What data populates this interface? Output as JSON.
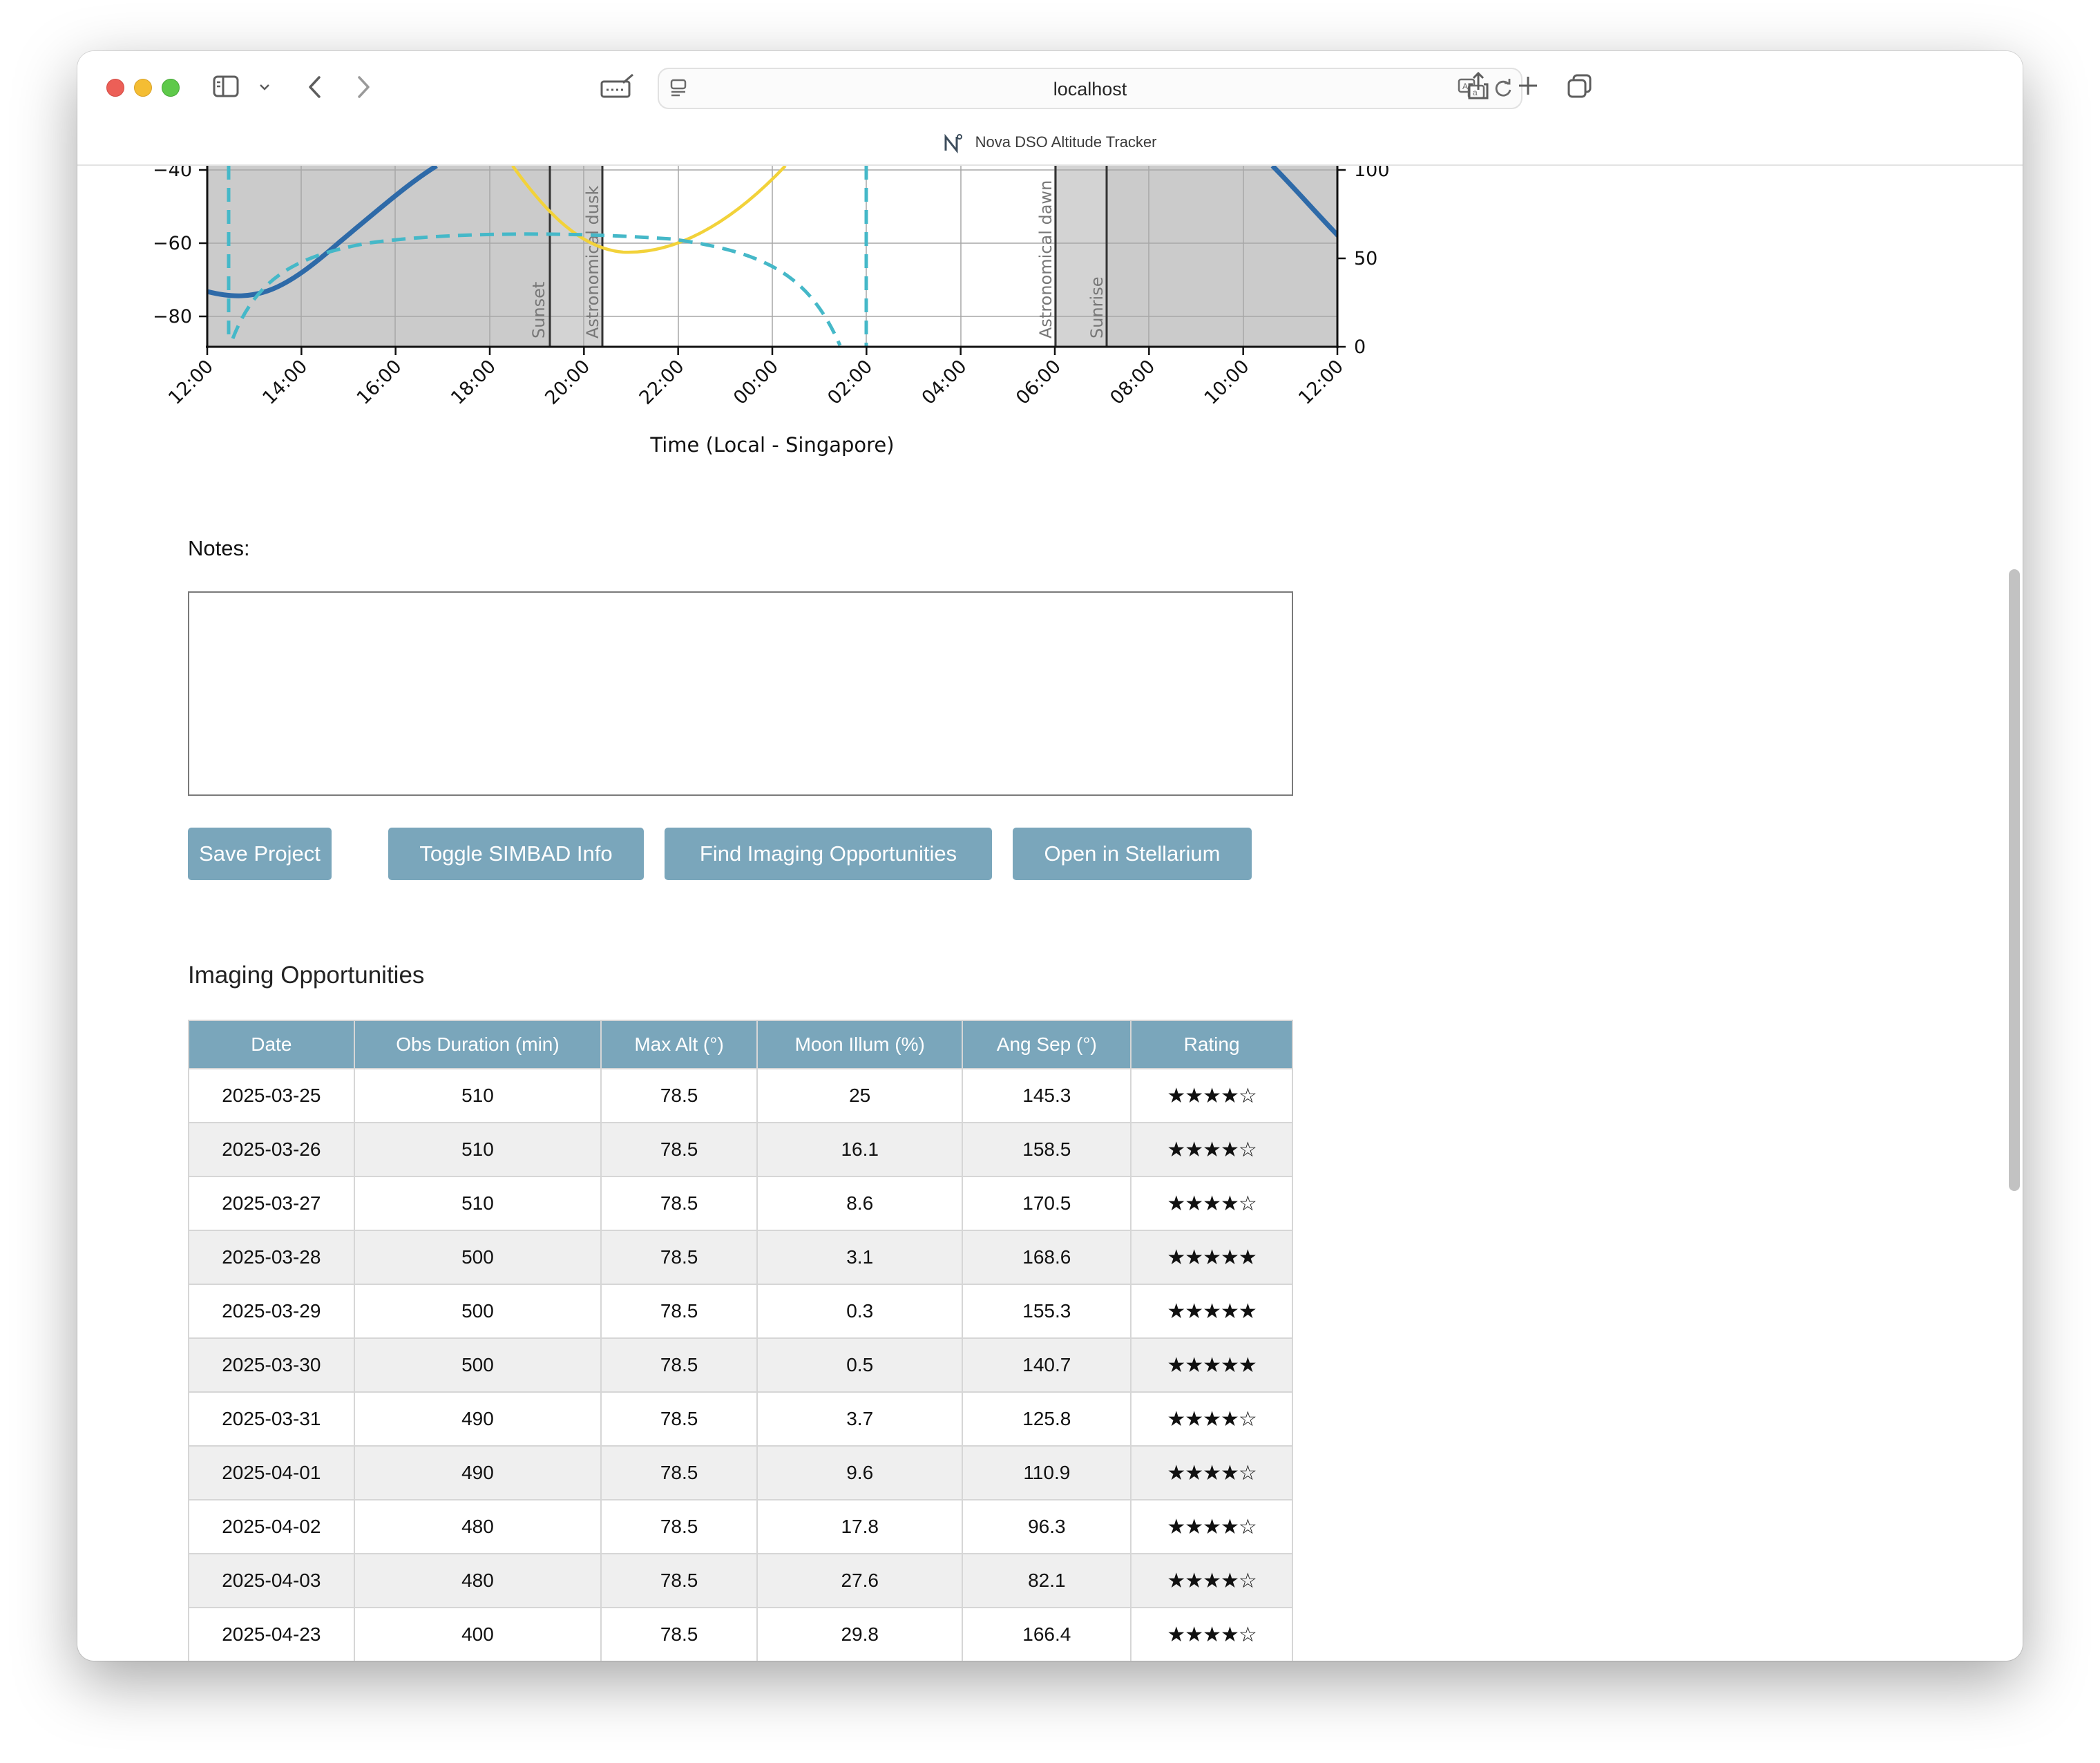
{
  "browser": {
    "url": "localhost",
    "tab_title": "Nova DSO Altitude Tracker"
  },
  "chart_data": {
    "type": "line",
    "xlabel": "Time (Local - Singapore)",
    "x_ticks": [
      "12:00",
      "14:00",
      "16:00",
      "18:00",
      "20:00",
      "22:00",
      "00:00",
      "02:00",
      "04:00",
      "06:00",
      "08:00",
      "10:00",
      "12:00"
    ],
    "left_y_ticks": [
      "−40",
      "−60",
      "−80"
    ],
    "right_y_ticks": [
      "100",
      "50",
      "0"
    ],
    "event_labels": [
      "Sunset",
      "Astronomical dusk",
      "Astronomical dawn",
      "Sunrise"
    ],
    "colors": {
      "target_altitude": "#2e6aa8",
      "moon_altitude": "#f2d23a",
      "dashed_series": "#45b8c8",
      "night_shade": "#c8c8c8"
    }
  },
  "notes": {
    "label": "Notes:",
    "value": ""
  },
  "buttons": {
    "save": "Save Project",
    "simbad": "Toggle SIMBAD Info",
    "find": "Find Imaging Opportunities",
    "stellarium": "Open in Stellarium"
  },
  "opportunities": {
    "title": "Imaging Opportunities",
    "headers": [
      "Date",
      "Obs Duration (min)",
      "Max Alt (°)",
      "Moon Illum (%)",
      "Ang Sep (°)",
      "Rating"
    ],
    "rows": [
      [
        "2025-03-25",
        "510",
        "78.5",
        "25",
        "145.3",
        "★★★★☆"
      ],
      [
        "2025-03-26",
        "510",
        "78.5",
        "16.1",
        "158.5",
        "★★★★☆"
      ],
      [
        "2025-03-27",
        "510",
        "78.5",
        "8.6",
        "170.5",
        "★★★★☆"
      ],
      [
        "2025-03-28",
        "500",
        "78.5",
        "3.1",
        "168.6",
        "★★★★★"
      ],
      [
        "2025-03-29",
        "500",
        "78.5",
        "0.3",
        "155.3",
        "★★★★★"
      ],
      [
        "2025-03-30",
        "500",
        "78.5",
        "0.5",
        "140.7",
        "★★★★★"
      ],
      [
        "2025-03-31",
        "490",
        "78.5",
        "3.7",
        "125.8",
        "★★★★☆"
      ],
      [
        "2025-04-01",
        "490",
        "78.5",
        "9.6",
        "110.9",
        "★★★★☆"
      ],
      [
        "2025-04-02",
        "480",
        "78.5",
        "17.8",
        "96.3",
        "★★★★☆"
      ],
      [
        "2025-04-03",
        "480",
        "78.5",
        "27.6",
        "82.1",
        "★★★★☆"
      ],
      [
        "2025-04-23",
        "400",
        "78.5",
        "29.8",
        "166.4",
        "★★★★☆"
      ]
    ]
  }
}
